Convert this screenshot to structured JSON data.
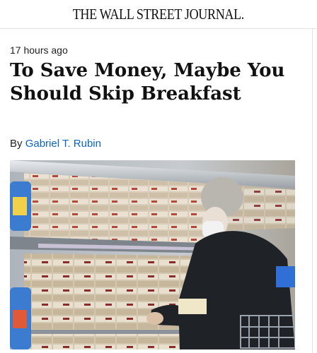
{
  "masthead": {
    "title": "THE WALL STREET JOURNAL."
  },
  "article": {
    "timestamp": "17 hours ago",
    "headline": "To Save Money, Maybe You Should Skip Breakfast",
    "byline_prefix": "By",
    "author": "Gabriel T. Rubin"
  },
  "photo": {
    "icon": "grocery-eggs-photo"
  },
  "colors": {
    "author_link": "#0b64c5",
    "headline": "#111111"
  }
}
